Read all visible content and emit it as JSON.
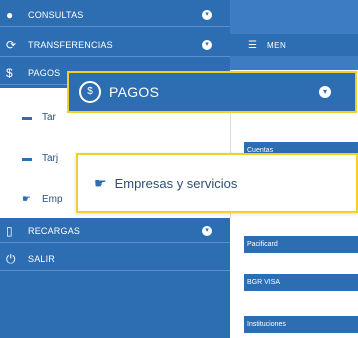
{
  "colors": {
    "nav_blue": "#2d6db2",
    "highlight": "#f4cf2a"
  },
  "sidebar": {
    "items": [
      {
        "label": "CONSULTAS",
        "icon": "user-icon"
      },
      {
        "label": "TRANSFERENCIAS",
        "icon": "transfer-icon"
      },
      {
        "label": "PAGOS",
        "icon": "payments-icon"
      },
      {
        "label": "RECARGAS",
        "icon": "phone-icon"
      },
      {
        "label": "SALIR",
        "icon": "power-icon"
      }
    ],
    "pagos_submenu": [
      {
        "label": "Tar",
        "icon": "card-icon"
      },
      {
        "label": "Tarj",
        "icon": "card-icon"
      },
      {
        "label": "Emp",
        "icon": "handshake-icon"
      }
    ]
  },
  "menu_bar": {
    "label": "MEN",
    "icon": "menu-icon"
  },
  "categories": [
    {
      "label": "Cuentas"
    },
    {
      "label": "Pacificard"
    },
    {
      "label": "BGR VISA"
    },
    {
      "label": "Instituciones"
    }
  ],
  "callouts": {
    "pagos": {
      "label": "PAGOS",
      "icon": "payments-icon"
    },
    "empresas": {
      "label": "Empresas y servicios",
      "icon": "handshake-icon"
    }
  }
}
